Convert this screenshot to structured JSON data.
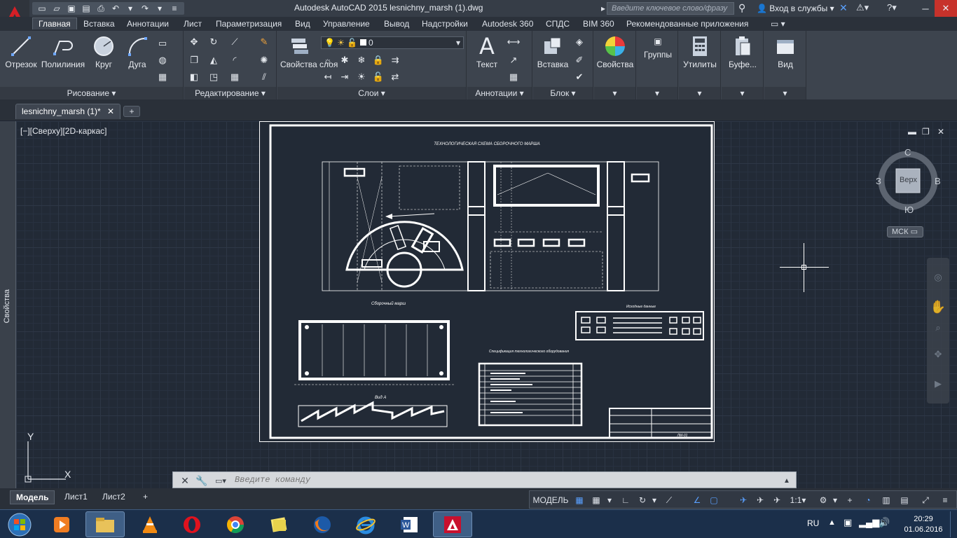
{
  "window": {
    "title": "Autodesk AutoCAD 2015    lesnichny_marsh (1).dwg",
    "search_placeholder": "Введите ключевое слово/фразу",
    "signin": "Вход в службы"
  },
  "ribbon_tabs": [
    "Главная",
    "Вставка",
    "Аннотации",
    "Лист",
    "Параметризация",
    "Вид",
    "Управление",
    "Вывод",
    "Надстройки",
    "Autodesk 360",
    "СПДС",
    "BIM 360",
    "Рекомендованные приложения"
  ],
  "draw_panel": {
    "buttons": [
      "Отрезок",
      "Полилиния",
      "Круг",
      "Дуга"
    ],
    "footer": "Рисование"
  },
  "modify_panel": {
    "footer": "Редактирование"
  },
  "layers_panel": {
    "layer_props": "Свойства слоя",
    "current_layer": "0",
    "footer": "Слои"
  },
  "annot_panel": {
    "text_btn": "Текст",
    "footer": "Аннотации"
  },
  "block_panel": {
    "insert_btn": "Вставка",
    "footer": "Блок"
  },
  "extra_panels": [
    "Свойства",
    "Группы",
    "Утилиты",
    "Буфе...",
    "Вид"
  ],
  "document": {
    "tab": "lesnichny_marsh (1)*"
  },
  "properties_strip": "Свойства",
  "viewport": {
    "label": "[−][Сверху][2D-каркас]"
  },
  "viewcube": {
    "n": "С",
    "s": "Ю",
    "w": "З",
    "e": "В",
    "face": "Верх",
    "ucs": "МСК"
  },
  "ucs_axes": {
    "x": "X",
    "y": "Y"
  },
  "command": {
    "placeholder": "Введите команду"
  },
  "layout_tabs": [
    "Модель",
    "Лист1",
    "Лист2"
  ],
  "status": {
    "model": "МОДЕЛЬ",
    "scale": "1:1"
  },
  "drawing": {
    "title": "ТЕХНОЛОГИЧЕСКАЯ СХЕМА СБОРОЧНОГО МАРША",
    "section_a": "Вид А",
    "spec_title": "Спецификация технологического оборудования",
    "legend_title": "Исходные данные",
    "march_title": "Сборочный марш",
    "stamp_code": "ЛМ-01"
  },
  "tray": {
    "lang": "RU",
    "time": "20:29",
    "date": "01.06.2016"
  },
  "colors": {
    "accent": "#d41f26",
    "ribbon": "#3d444e",
    "canvas": "#222a36"
  }
}
